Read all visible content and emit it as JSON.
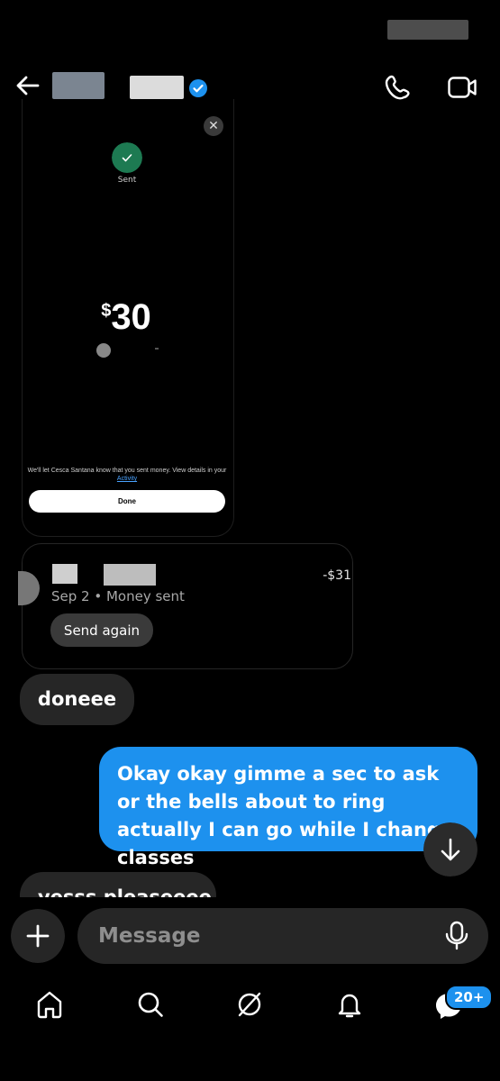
{
  "header": {
    "back_icon": "arrow-left-icon",
    "verified_icon": "verified-badge-icon",
    "call_icon": "phone-icon",
    "video_icon": "video-camera-icon",
    "accent": "#1d91ee"
  },
  "receipt": {
    "status": "Sent",
    "currency_symbol": "$",
    "amount": "30",
    "notice_text": "We'll let Cesca Santana know that you sent money. View details in your",
    "notice_link": "Activity",
    "done_label": "Done",
    "close_icon": "close-icon",
    "status_color": "#1d7a52"
  },
  "transaction": {
    "amount": "-$31",
    "meta": "Sep 2 • Money sent",
    "send_again_label": "Send again"
  },
  "messages": [
    {
      "side": "left",
      "text": "doneee"
    },
    {
      "side": "right",
      "text": "Okay okay gimme a sec to ask or the bells about to ring actually I can go while I change classes"
    },
    {
      "side": "left",
      "text": "yesss pleaseeee"
    }
  ],
  "composer": {
    "placeholder": "Message",
    "plus_icon": "plus-icon",
    "mic_icon": "microphone-icon"
  },
  "nav": {
    "items": [
      {
        "icon": "home-icon"
      },
      {
        "icon": "search-icon"
      },
      {
        "icon": "explore-icon"
      },
      {
        "icon": "bell-icon"
      },
      {
        "icon": "messages-icon"
      }
    ],
    "badge": "20+"
  }
}
